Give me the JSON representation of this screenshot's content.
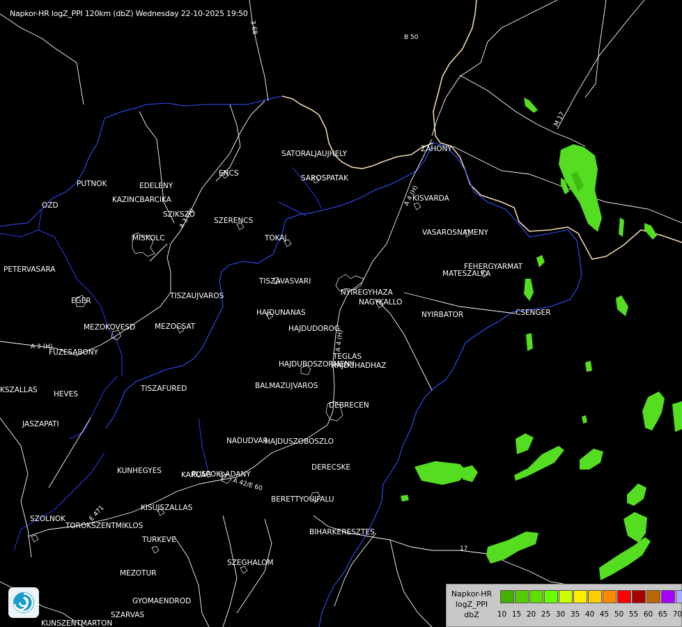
{
  "header": {
    "title": "Napkor-HR logZ_PPI 120km (dbZ) Wednesday 22-10-2025 19:50"
  },
  "towns": [
    {
      "name": "SATORALJAUJHELY"
    },
    {
      "name": "ZAHONY"
    },
    {
      "name": "SAROSPATAK"
    },
    {
      "name": "PUTNOK"
    },
    {
      "name": "EDELENY"
    },
    {
      "name": "ENCS"
    },
    {
      "name": "KAZINCBARCIKA"
    },
    {
      "name": "OZD"
    },
    {
      "name": "SZIKSZO"
    },
    {
      "name": "KISVARDA"
    },
    {
      "name": "SZERENCS"
    },
    {
      "name": "MISKOLC"
    },
    {
      "name": "TOKAJ"
    },
    {
      "name": "VASAROSNAMENY"
    },
    {
      "name": "PETERVASARA"
    },
    {
      "name": "FEHERGYARMAT"
    },
    {
      "name": "MATESZALKA"
    },
    {
      "name": "TISZAVASVARI"
    },
    {
      "name": "NYIREGYHAZA"
    },
    {
      "name": "EGER"
    },
    {
      "name": "TISZAUJVAROS"
    },
    {
      "name": "NAGYKALLO"
    },
    {
      "name": "HAJDUNANAS"
    },
    {
      "name": "NYIRBATOR"
    },
    {
      "name": "CSENGER"
    },
    {
      "name": "MEZOKOVESD"
    },
    {
      "name": "MEZOCSAT"
    },
    {
      "name": "HAJDUDOROG"
    },
    {
      "name": "FUZESABONY"
    },
    {
      "name": "TEGLAS"
    },
    {
      "name": "HAJDUBOSZORMENY"
    },
    {
      "name": "HAJDUHADHAZ"
    },
    {
      "name": "BALMAZUJVAROS"
    },
    {
      "name": "TISZAFURED"
    },
    {
      "name": "KSZALLAS"
    },
    {
      "name": "HEVES"
    },
    {
      "name": "DEBRECEN"
    },
    {
      "name": "JASZAPATI"
    },
    {
      "name": "NADUDVAR"
    },
    {
      "name": "HAJDUSZOBOSZLO"
    },
    {
      "name": "KUNHEGYES"
    },
    {
      "name": "DERECSKE"
    },
    {
      "name": "KARCAG"
    },
    {
      "name": "PUSPOKLADANY"
    },
    {
      "name": "BERETTYOUJFALU"
    },
    {
      "name": "KISUJSZALLAS"
    },
    {
      "name": "SZOLNOK"
    },
    {
      "name": "TOROKSZENTMIKLOS"
    },
    {
      "name": "BIHARKERESZTES"
    },
    {
      "name": "TURKEVE"
    },
    {
      "name": "SZEGHALOM"
    },
    {
      "name": "MEZOTUR"
    },
    {
      "name": "GYOMAENDROD"
    },
    {
      "name": "SZARVAS"
    },
    {
      "name": "KUNSZENTMARTON"
    }
  ],
  "roads": [
    {
      "name": "B 50"
    },
    {
      "name": "3 68"
    },
    {
      "name": "M 17"
    },
    {
      "name": "A 4 (H)"
    },
    {
      "name": "A 3 (H)"
    },
    {
      "name": "A 3 (H)"
    },
    {
      "name": "A 4 (H)"
    },
    {
      "name": "A 42/E 60"
    },
    {
      "name": "E 471"
    },
    {
      "name": "17"
    }
  ],
  "legend": {
    "title_lines": [
      "Napkor-HR",
      "logZ_PPI",
      "dbZ"
    ],
    "ticks": [
      "10",
      "15",
      "20",
      "25",
      "30",
      "35",
      "40",
      "45",
      "50",
      "55",
      "60",
      "65",
      "70"
    ],
    "colors": [
      "#44b000",
      "#55cc00",
      "#5fdd00",
      "#66ff00",
      "#ccff00",
      "#ffee00",
      "#ffcc00",
      "#ff8800",
      "#ff0000",
      "#aa0000",
      "#bb6600",
      "#aa00ff",
      "#aaaaff"
    ]
  },
  "logo": {
    "icon": "swirl-logo-icon"
  }
}
